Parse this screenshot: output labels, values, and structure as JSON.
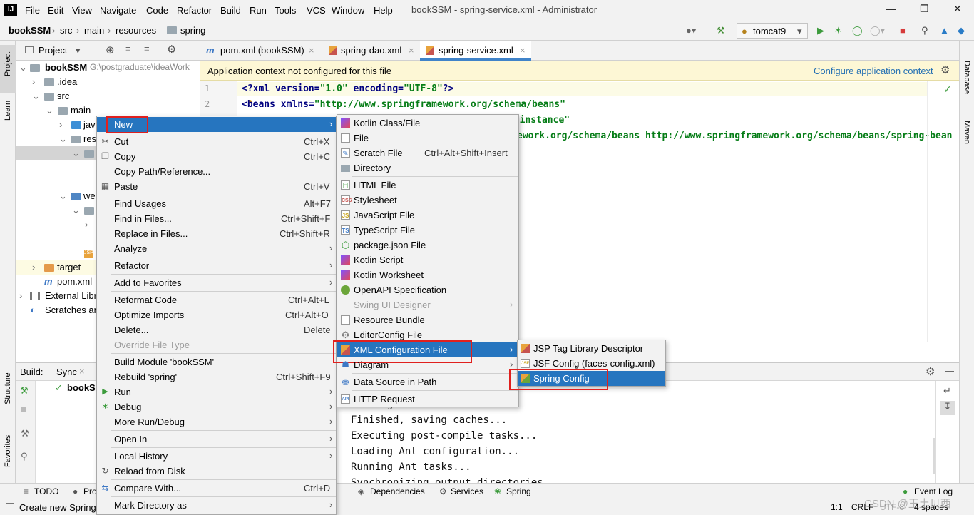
{
  "menubar": {
    "logo": "IJ",
    "items": [
      "File",
      "Edit",
      "View",
      "Navigate",
      "Code",
      "Refactor",
      "Build",
      "Run",
      "Tools",
      "VCS",
      "Window",
      "Help"
    ],
    "window_title": "bookSSM - spring-service.xml - Administrator"
  },
  "navbar": {
    "crumbs": [
      "bookSSM",
      "src",
      "main",
      "resources",
      "spring"
    ],
    "run_config": "tomcat9"
  },
  "project": {
    "title": "Project",
    "root": "bookSSM",
    "root_path": "G:\\postgraduate\\ideaWork",
    "items": [
      ".idea",
      "src",
      "main",
      "java",
      "res",
      "web",
      "target",
      "pom.xml",
      "External Libr",
      "Scratches an"
    ]
  },
  "tabs": [
    {
      "label": "pom.xml (bookSSM)"
    },
    {
      "label": "spring-dao.xml"
    },
    {
      "label": "spring-service.xml"
    }
  ],
  "banner": {
    "message": "Application context not configured for this file",
    "action": "Configure application context"
  },
  "editor": {
    "line_numbers": [
      "1",
      "2"
    ],
    "line1_a": "<?xml version=",
    "line1_b": "\"1.0\"",
    "line1_c": " encoding=",
    "line1_d": "\"UTF-8\"",
    "line1_e": "?>",
    "line2_a": "<beans xmlns=",
    "line2_b": "\"http://www.springframework.org/schema/beans\"",
    "line3_tail": "a-instance\"",
    "line4_tail": "ework.org/schema/beans http://www.springframework.org/schema/beans/spring-bean"
  },
  "build": {
    "tab_build": "Build:",
    "tab_sync": "Sync",
    "root_item": "bookSS",
    "output": [
      "Running 'after' tasks",
      "Finished, saving caches...",
      "Executing post-compile tasks...",
      "Loading Ant configuration...",
      "Running Ant tasks...",
      "Synchronizing output directories..."
    ]
  },
  "bottom_tools": [
    "TODO",
    "Pro",
    "Dependencies",
    "Services",
    "Spring",
    "Event Log"
  ],
  "status": {
    "message": "Create new Spring",
    "position": "1:1",
    "line_sep": "CRLF",
    "encoding": "UTF-8",
    "indent": "4 spaces",
    "watermark": "CSDN @王土贝西"
  },
  "side_tabs": {
    "left": [
      "Project",
      "Learn",
      "Structure",
      "Favorites"
    ],
    "right": [
      "Database",
      "Maven"
    ]
  },
  "context_menu": [
    {
      "label": "New",
      "shortcut": "",
      "submenu": true
    },
    {
      "label": "Cut",
      "shortcut": "Ctrl+X"
    },
    {
      "label": "Copy",
      "shortcut": "Ctrl+C"
    },
    {
      "label": "Copy Path/Reference...",
      "shortcut": ""
    },
    {
      "label": "Paste",
      "shortcut": "Ctrl+V"
    },
    {
      "label": "Find Usages",
      "shortcut": "Alt+F7"
    },
    {
      "label": "Find in Files...",
      "shortcut": "Ctrl+Shift+F"
    },
    {
      "label": "Replace in Files...",
      "shortcut": "Ctrl+Shift+R"
    },
    {
      "label": "Analyze",
      "shortcut": "",
      "submenu": true
    },
    {
      "label": "Refactor",
      "shortcut": "",
      "submenu": true
    },
    {
      "label": "Add to Favorites",
      "shortcut": "",
      "submenu": true
    },
    {
      "label": "Reformat Code",
      "shortcut": "Ctrl+Alt+L"
    },
    {
      "label": "Optimize Imports",
      "shortcut": "Ctrl+Alt+O"
    },
    {
      "label": "Delete...",
      "shortcut": "Delete"
    },
    {
      "label": "Override File Type",
      "shortcut": ""
    },
    {
      "label": "Build Module 'bookSSM'",
      "shortcut": ""
    },
    {
      "label": "Rebuild 'spring'",
      "shortcut": "Ctrl+Shift+F9"
    },
    {
      "label": "Run",
      "shortcut": "",
      "submenu": true
    },
    {
      "label": "Debug",
      "shortcut": "",
      "submenu": true
    },
    {
      "label": "More Run/Debug",
      "shortcut": "",
      "submenu": true
    },
    {
      "label": "Open In",
      "shortcut": "",
      "submenu": true
    },
    {
      "label": "Local History",
      "shortcut": "",
      "submenu": true
    },
    {
      "label": "Reload from Disk",
      "shortcut": ""
    },
    {
      "label": "Compare With...",
      "shortcut": "Ctrl+D"
    },
    {
      "label": "Mark Directory as",
      "shortcut": "",
      "submenu": true
    }
  ],
  "new_submenu": [
    {
      "label": "Kotlin Class/File",
      "icon": "kotlin-icon"
    },
    {
      "label": "File",
      "icon": "file-icon"
    },
    {
      "label": "Scratch File",
      "shortcut": "Ctrl+Alt+Shift+Insert",
      "icon": "scratch-icon"
    },
    {
      "label": "Directory",
      "icon": "folder-icon"
    },
    {
      "label": "HTML File",
      "icon": "html-icon"
    },
    {
      "label": "Stylesheet",
      "icon": "css-icon"
    },
    {
      "label": "JavaScript File",
      "icon": "js-icon"
    },
    {
      "label": "TypeScript File",
      "icon": "ts-icon"
    },
    {
      "label": "package.json File",
      "icon": "npm-icon"
    },
    {
      "label": "Kotlin Script",
      "icon": "kotlin-icon"
    },
    {
      "label": "Kotlin Worksheet",
      "icon": "kotlin-icon"
    },
    {
      "label": "OpenAPI Specification",
      "icon": "openapi-icon"
    },
    {
      "label": "Swing UI Designer",
      "icon": ""
    },
    {
      "label": "Resource Bundle",
      "icon": "bundle-icon"
    },
    {
      "label": "EditorConfig File",
      "icon": "gear-icon"
    },
    {
      "label": "XML Configuration File",
      "icon": "xml-icon"
    },
    {
      "label": "Diagram",
      "icon": "diagram-icon"
    },
    {
      "label": "Data Source in Path",
      "icon": "database-icon"
    },
    {
      "label": "HTTP Request",
      "icon": "api-icon"
    }
  ],
  "xml_submenu": [
    {
      "label": "JSP Tag Library Descriptor"
    },
    {
      "label": "JSF Config (faces-config.xml)"
    },
    {
      "label": "Spring Config"
    }
  ],
  "colors": {
    "selection": "#2675bf",
    "highlight_box": "#e0201e",
    "banner": "#fdf7d5"
  }
}
